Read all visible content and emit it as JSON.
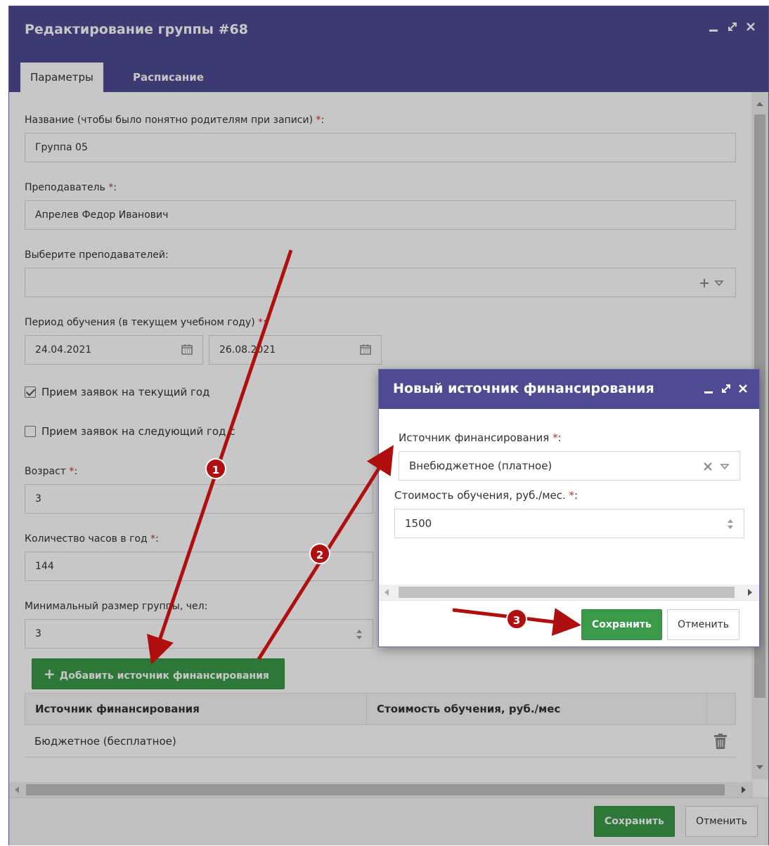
{
  "window": {
    "title": "Редактирование группы #68",
    "tabs": [
      {
        "label": "Параметры",
        "active": true
      },
      {
        "label": "Расписание",
        "active": false
      }
    ]
  },
  "form": {
    "name_label": "Название (чтобы было понятно родителям при записи)",
    "name_value": "Группа 05",
    "teacher_label": "Преподаватель",
    "teacher_value": "Апрелев Федор Иванович",
    "teachers_label": "Выберите преподавателей:",
    "period_label": "Период обучения (в текущем учебном году)",
    "date_from": "24.04.2021",
    "date_to": "26.08.2021",
    "accept_current": "Прием заявок на текущий год",
    "accept_next": "Прием заявок на следующий год с",
    "age_label": "Возраст",
    "age_value": "3",
    "hours_label": "Количество часов в год",
    "hours_value": "144",
    "min_size_label": "Минимальный размер группы, чел:",
    "min_size_value": "3",
    "required_mark": "*",
    "colon": ":"
  },
  "add_source_button": "Добавить источник финансирования",
  "table": {
    "headers": [
      "Источник финансирования",
      "Стоимость обучения, руб./мес"
    ],
    "rows": [
      {
        "source": "Бюджетное (бесплатное)",
        "cost": ""
      }
    ]
  },
  "footer": {
    "save": "Сохранить",
    "cancel": "Отменить"
  },
  "dialog": {
    "title": "Новый источник финансирования",
    "source_label": "Источник финансирования",
    "source_value": "Внебюджетное (платное)",
    "cost_label": "Стоимость обучения, руб./мес.",
    "cost_value": "1500",
    "save": "Сохранить",
    "cancel": "Отменить"
  },
  "annotations": [
    "1",
    "2",
    "3"
  ],
  "colors": {
    "header": "#4f4a92",
    "green": "#3a9a4a",
    "annotation_red": "#b00f0f",
    "required": "#c9302c"
  }
}
